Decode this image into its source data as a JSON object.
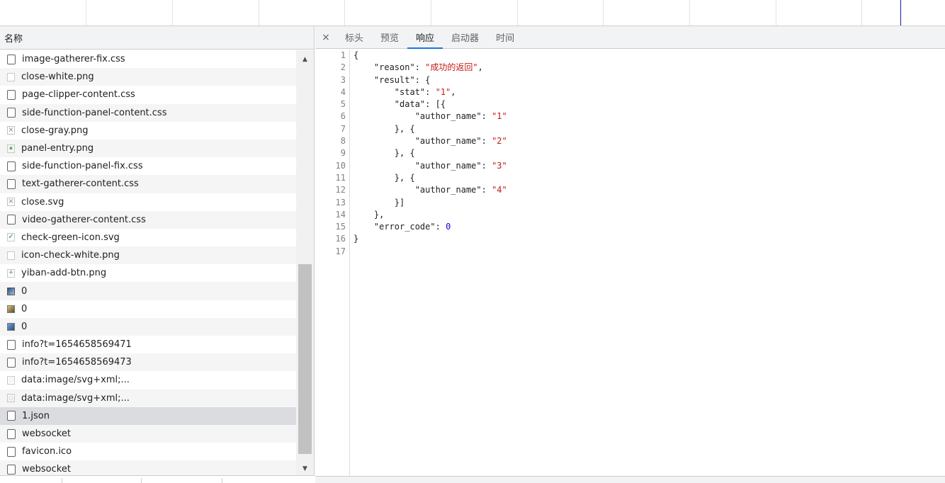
{
  "list_header": "名称",
  "requests": [
    {
      "name": "image-gatherer-fix.css",
      "icon": "doc"
    },
    {
      "name": "close-white.png",
      "icon": "img-light"
    },
    {
      "name": "page-clipper-content.css",
      "icon": "doc"
    },
    {
      "name": "side-function-panel-content.css",
      "icon": "doc"
    },
    {
      "name": "close-gray.png",
      "icon": "img-x"
    },
    {
      "name": "panel-entry.png",
      "icon": "img-dot"
    },
    {
      "name": "side-function-panel-fix.css",
      "icon": "doc"
    },
    {
      "name": "text-gatherer-content.css",
      "icon": "doc"
    },
    {
      "name": "close.svg",
      "icon": "img-x"
    },
    {
      "name": "video-gatherer-content.css",
      "icon": "doc"
    },
    {
      "name": "check-green-icon.svg",
      "icon": "img-check"
    },
    {
      "name": "icon-check-white.png",
      "icon": "img-light"
    },
    {
      "name": "yiban-add-btn.png",
      "icon": "img-plus"
    },
    {
      "name": "0",
      "icon": "thumb1"
    },
    {
      "name": "0",
      "icon": "thumb2"
    },
    {
      "name": "0",
      "icon": "thumb3"
    },
    {
      "name": "info?t=1654658569471",
      "icon": "doc"
    },
    {
      "name": "info?t=1654658569473",
      "icon": "doc"
    },
    {
      "name": "data:image/svg+xml;...",
      "icon": "svgdata"
    },
    {
      "name": "data:image/svg+xml;...",
      "icon": "svgdata"
    },
    {
      "name": "1.json",
      "icon": "doc",
      "selected": true
    },
    {
      "name": "websocket",
      "icon": "doc"
    },
    {
      "name": "favicon.ico",
      "icon": "doc"
    },
    {
      "name": "websocket",
      "icon": "doc"
    }
  ],
  "tabs": [
    {
      "label": "标头",
      "active": false
    },
    {
      "label": "预览",
      "active": false
    },
    {
      "label": "响应",
      "active": true
    },
    {
      "label": "启动器",
      "active": false
    },
    {
      "label": "时间",
      "active": false
    }
  ],
  "close_glyph": "×",
  "scroll_up_glyph": "▲",
  "scroll_down_glyph": "▼",
  "response_lines": [
    [
      [
        "p",
        "{"
      ]
    ],
    [
      [
        "p",
        "    "
      ],
      [
        "k",
        "\"reason\""
      ],
      [
        "p",
        ": "
      ],
      [
        "s",
        "\"成功的返回\""
      ],
      [
        "p",
        ","
      ]
    ],
    [
      [
        "p",
        "    "
      ],
      [
        "k",
        "\"result\""
      ],
      [
        "p",
        ": {"
      ]
    ],
    [
      [
        "p",
        "        "
      ],
      [
        "k",
        "\"stat\""
      ],
      [
        "p",
        ": "
      ],
      [
        "s",
        "\"1\""
      ],
      [
        "p",
        ","
      ]
    ],
    [
      [
        "p",
        "        "
      ],
      [
        "k",
        "\"data\""
      ],
      [
        "p",
        ": [{"
      ]
    ],
    [
      [
        "p",
        "            "
      ],
      [
        "k",
        "\"author_name\""
      ],
      [
        "p",
        ": "
      ],
      [
        "s",
        "\"1\""
      ]
    ],
    [
      [
        "p",
        "        }, {"
      ]
    ],
    [
      [
        "p",
        "            "
      ],
      [
        "k",
        "\"author_name\""
      ],
      [
        "p",
        ": "
      ],
      [
        "s",
        "\"2\""
      ]
    ],
    [
      [
        "p",
        "        }, {"
      ]
    ],
    [
      [
        "p",
        "            "
      ],
      [
        "k",
        "\"author_name\""
      ],
      [
        "p",
        ": "
      ],
      [
        "s",
        "\"3\""
      ]
    ],
    [
      [
        "p",
        "        }, {"
      ]
    ],
    [
      [
        "p",
        "            "
      ],
      [
        "k",
        "\"author_name\""
      ],
      [
        "p",
        ": "
      ],
      [
        "s",
        "\"4\""
      ]
    ],
    [
      [
        "p",
        "        }]"
      ]
    ],
    [
      [
        "p",
        "    },"
      ]
    ],
    [
      [
        "p",
        "    "
      ],
      [
        "k",
        "\"error_code\""
      ],
      [
        "p",
        ": "
      ],
      [
        "n",
        "0"
      ]
    ],
    [
      [
        "p",
        "}"
      ]
    ],
    [
      [
        "p",
        ""
      ]
    ]
  ],
  "colors": {
    "active_tab": "#1a73e8",
    "string": "#c41a16",
    "number": "#1c00cf",
    "selected_row": "#dadce0"
  }
}
